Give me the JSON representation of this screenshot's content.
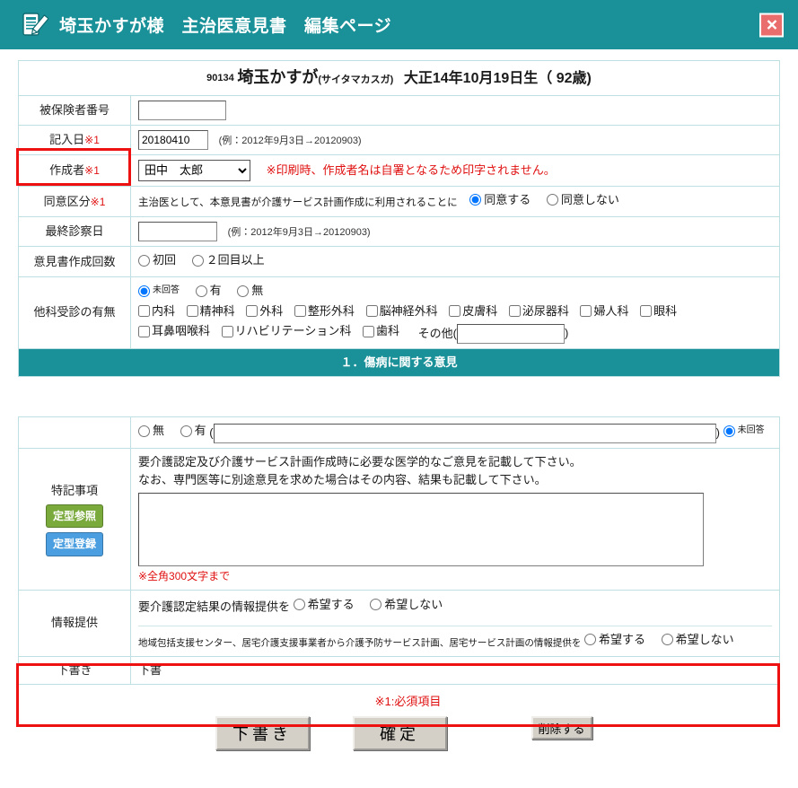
{
  "titlebar": {
    "icon": "document-pencil-icon",
    "title": "埼玉かすが様　主治医意見書　編集ページ",
    "close_label": "X",
    "bg_color": "#1a9198",
    "close_color": "#ea6d6d"
  },
  "patient": {
    "code": "90134",
    "name": "埼玉かすが",
    "kana": "(サイタマカスガ)",
    "birth": "大正14年10月19日生（ 92歳)"
  },
  "rows": {
    "hoken": {
      "label": "被保険者番号",
      "value": "",
      "highlighted": true
    },
    "kinyubi": {
      "label": "記入日",
      "required_mark": "※1",
      "value": "20180410",
      "hint": "(例：2012年9月3日→20120903)"
    },
    "sakuseisha": {
      "label": "作成者",
      "required_mark": "※1",
      "selected": "田中　太郎",
      "options": [
        "田中　太郎"
      ],
      "note": "※印刷時、作成者名は自署となるため印字されません。"
    },
    "doui": {
      "label": "同意区分",
      "required_mark": "※1",
      "lead": "主治医として、本意見書が介護サービス計画作成に利用されることに",
      "options": [
        {
          "label": "同意する",
          "checked": true
        },
        {
          "label": "同意しない",
          "checked": false
        }
      ]
    },
    "saishu": {
      "label": "最終診察日",
      "value": "",
      "hint": "(例：2012年9月3日→20120903)"
    },
    "kaisu": {
      "label": "意見書作成回数",
      "options": [
        {
          "label": "初回",
          "checked": false
        },
        {
          "label": "２回目以上",
          "checked": false
        }
      ]
    },
    "takka": {
      "label": "他科受診の有無",
      "radios": [
        {
          "label": "未回答",
          "checked": true
        },
        {
          "label": "有",
          "checked": false
        },
        {
          "label": "無",
          "checked": false
        }
      ],
      "checks_line1": [
        "内科",
        "精神科",
        "外科",
        "整形外科",
        "脳神経外科",
        "皮膚科",
        "泌尿器科",
        "婦人科",
        "眼科"
      ],
      "checks_line2": [
        "耳鼻咽喉科",
        "リハビリテーション科",
        "歯科"
      ],
      "other_label": "その他(",
      "other_value": "",
      "other_close": ")"
    }
  },
  "section1": {
    "title": "１．傷病に関する意見"
  },
  "lower": {
    "umu_row": {
      "options": [
        {
          "label": "無",
          "checked": false
        },
        {
          "label": "有",
          "checked": false
        }
      ],
      "open_paren": "(",
      "text_value": "",
      "close_paren": ")",
      "unanswered": {
        "label": "未回答",
        "checked": true
      }
    },
    "tokki": {
      "label": "特記事項",
      "btn_ref": "定型参照",
      "btn_reg": "定型登録",
      "desc_line1": "要介護認定及び介護サービス計画作成時に必要な医学的なご意見を記載して下さい。",
      "desc_line2": "なお、専門医等に別途意見を求めた場合はその内容、結果も記載して下さい。",
      "textarea_value": "",
      "limit_note": "※全角300文字まで"
    },
    "joho": {
      "label": "情報提供",
      "highlighted": true,
      "line1_lead": "要介護認定結果の情報提供を",
      "line1_options": [
        {
          "label": "希望する",
          "checked": false
        },
        {
          "label": "希望しない",
          "checked": false
        }
      ],
      "line2_lead": "地域包括支援センター、居宅介護支援事業者から介護予防サービス計画、居宅サービス計画の情報提供を",
      "line2_options": [
        {
          "label": "希望する",
          "checked": false
        },
        {
          "label": "希望しない",
          "checked": false
        }
      ]
    },
    "shitagaki": {
      "label": "下書き",
      "value": "下書"
    }
  },
  "footer": {
    "required_note": "※1:必須項目",
    "buttons": [
      {
        "name": "draft",
        "label": "下書き"
      },
      {
        "name": "confirm",
        "label": "確定"
      },
      {
        "name": "delete",
        "label": "削除する"
      }
    ]
  }
}
